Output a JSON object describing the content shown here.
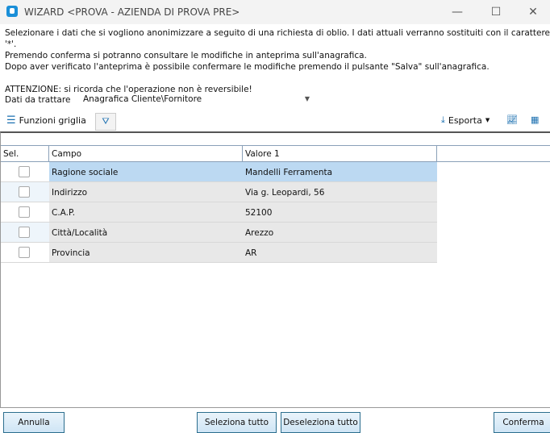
{
  "window": {
    "title": "WIZARD <PROVA - AZIENDA DI PROVA PRE>",
    "minimize": "—",
    "maximize": "☐",
    "close": "✕"
  },
  "message": {
    "line1": "Selezionare i dati che si vogliono anonimizzare a seguito di una richiesta di oblio. I dati attuali verranno sostituiti con il carattere '*'.",
    "line2": "Premendo conferma si potranno consultare le modifiche in anteprima sull'anagrafica.",
    "line3": "Dopo aver verificato l'anteprima è possibile confermare le modifiche premendo il pulsante \"Salva\" sull'anagrafica.",
    "warning": "ATTENZIONE: si ricorda che l'operazione non è reversibile!"
  },
  "dati": {
    "label": "Dati da trattare",
    "value": "Anagrafica Cliente\\Fornitore"
  },
  "toolbar": {
    "grid_functions": "Funzioni griglia",
    "export": "Esporta"
  },
  "grid": {
    "headers": [
      "Sel.",
      "Campo",
      "Valore 1"
    ],
    "rows": [
      {
        "campo": "Ragione sociale",
        "valore": "Mandelli Ferramenta",
        "checked": false
      },
      {
        "campo": "Indirizzo",
        "valore": "Via g. Leopardi, 56",
        "checked": false
      },
      {
        "campo": "C.A.P.",
        "valore": "52100",
        "checked": false
      },
      {
        "campo": "Città/Località",
        "valore": "Arezzo",
        "checked": false
      },
      {
        "campo": "Provincia",
        "valore": "AR",
        "checked": false
      }
    ]
  },
  "buttons": {
    "cancel": "Annulla",
    "select_all": "Seleziona tutto",
    "deselect_all": "Deseleziona tutto",
    "confirm": "Conferma"
  }
}
